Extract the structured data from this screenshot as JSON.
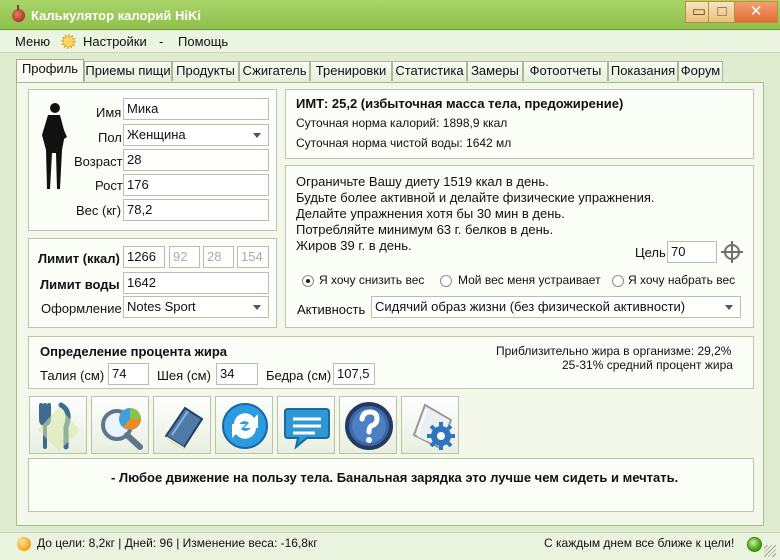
{
  "window": {
    "title": "Калькулятор калорий HiKi",
    "minimize": "▭",
    "maximize": "□",
    "close": "✕"
  },
  "menu": {
    "items": [
      "Меню",
      "Настройки",
      "-",
      "Помощь"
    ]
  },
  "tabs": [
    "Профиль",
    "Приемы пищи",
    "Продукты",
    "Сжигатель",
    "Тренировки",
    "Статистика",
    "Замеры",
    "Фотоотчеты",
    "Показания",
    "Форум"
  ],
  "profile": {
    "labels": {
      "name": "Имя",
      "sex": "Пол",
      "age": "Возраст",
      "height": "Рост",
      "weight": "Вес (кг)"
    },
    "name": "Мика",
    "sex": "Женщина",
    "age": "28",
    "height": "176",
    "weight": "78,2"
  },
  "limits": {
    "labels": {
      "calories": "Лимит (ккал)",
      "water": "Лимит воды",
      "theme": "Оформление"
    },
    "calories": "1266",
    "protein": "92",
    "fat": "28",
    "carbs": "154",
    "water": "1642",
    "theme": "Notes Sport"
  },
  "bmi": {
    "title": "ИМТ: 25,2 (избыточная масса тела, предожирение)",
    "daily_calories": "Суточная норма калорий: 1898,9 ккал",
    "daily_water": "Суточная норма чистой воды: 1642 мл"
  },
  "recommendations": {
    "lines": [
      "Ограничьте Вашу диету 1519 ккал в день.",
      "Будьте более активной и делайте физические упражнения.",
      "Делайте упражнения хотя бы 30 мин в день.",
      "Потребляйте минимум 63 г. белков в день.",
      "Жиров 39 г. в день."
    ],
    "goal_label": "Цель",
    "goal_value": "70",
    "options": [
      "Я хочу снизить вес",
      "Мой вес меня устраивает",
      "Я хочу набрать вес"
    ],
    "selected_option": 0,
    "activity_label": "Активность",
    "activity_value": "Сидячий образ жизни (без физической активности)"
  },
  "fat": {
    "title": "Определение процента жира",
    "waist_label": "Талия (см)",
    "waist": "74",
    "neck_label": "Шея (см)",
    "neck": "34",
    "hips_label": "Бедра (см)",
    "hips": "107,5",
    "result": "Приблизительно жира в организме: 29,2%",
    "average": "25-31% средний процент жира"
  },
  "icons": [
    "fork-knife-icon",
    "search-chart-icon",
    "book-icon",
    "refresh-icon",
    "message-icon",
    "help-icon",
    "settings-icon"
  ],
  "motivation": "- Любое движение на пользу тела. Банальная зарядка это лучше чем сидеть и мечтать.",
  "status": {
    "left": "До цели: 8,2кг | Дней: 96 | Изменение веса: -16,8кг",
    "right": "С каждым днем все ближе к цели!"
  },
  "colors": {
    "accent": "#8fc04d",
    "panel": "#fbfdf7",
    "close": "#df6b33",
    "success": "#48a514"
  }
}
